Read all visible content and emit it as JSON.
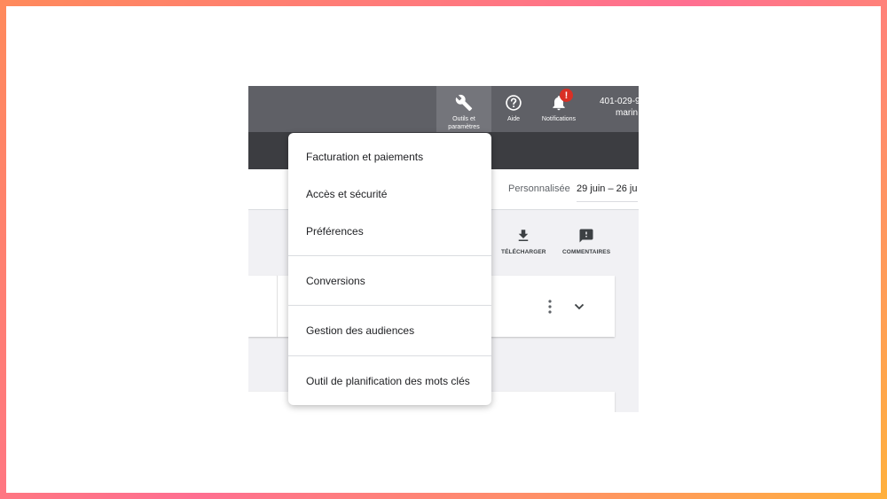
{
  "topbar": {
    "tools_label": "Outils et\nparamètres",
    "help_label": "Aide",
    "notifications_label": "Notifications",
    "notifications_badge": "!",
    "account_id": "401-029-9",
    "account_name": "marin"
  },
  "datebar": {
    "range_type": "Personnalisée",
    "range_value": "29 juin – 26 ju"
  },
  "actions": {
    "download_label": "TÉLÉCHARGER",
    "comments_label": "COMMENTAIRES"
  },
  "menu": {
    "items": [
      "Facturation et paiements",
      "Accès et sécurité",
      "Préférences",
      "Conversions",
      "Gestion des audiences",
      "Outil de planification des mots clés"
    ]
  },
  "colors": {
    "frame_gradient": [
      "#ff8a5b",
      "#ff6f91",
      "#ffb13d"
    ],
    "topbar": "#5f6066",
    "subbar": "#3c3d41",
    "badge": "#d93025"
  }
}
